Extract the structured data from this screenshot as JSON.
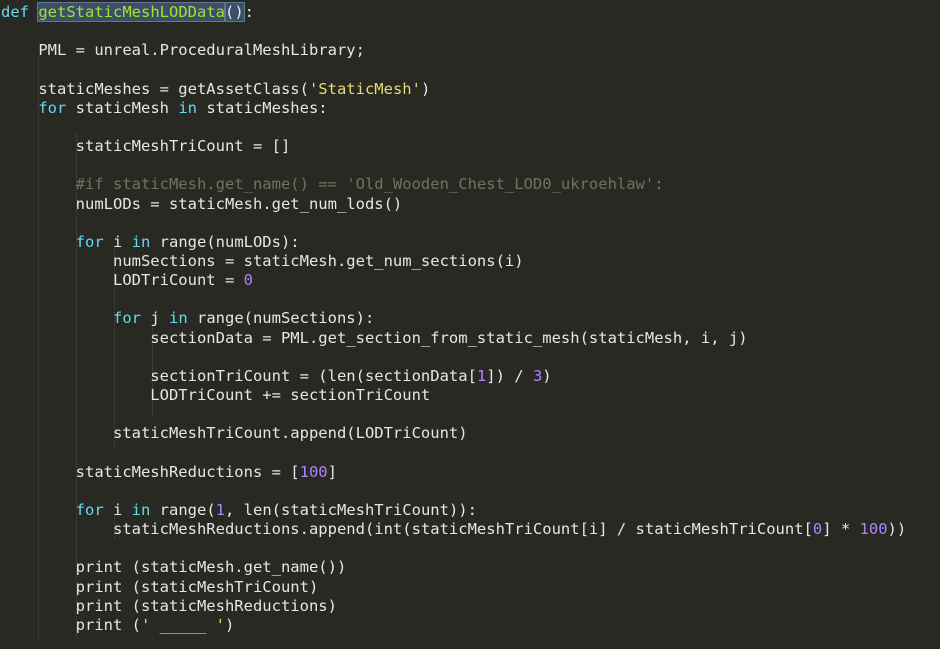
{
  "editor": {
    "background": "#282923",
    "lines": [
      {
        "tokens": [
          {
            "t": "def",
            "c": "kw"
          },
          {
            "t": " ",
            "c": "plain"
          },
          {
            "t": "getStaticMeshLODData",
            "c": "fn",
            "s": 1
          },
          {
            "t": "()",
            "c": "plain",
            "s": 1
          },
          {
            "t": ":",
            "c": "plain"
          }
        ]
      },
      {
        "tokens": []
      },
      {
        "tokens": [
          {
            "t": "    PML = unreal.ProceduralMeshLibrary;",
            "c": "plain"
          }
        ]
      },
      {
        "tokens": []
      },
      {
        "tokens": [
          {
            "t": "    staticMeshes = getAssetClass(",
            "c": "plain"
          },
          {
            "t": "'StaticMesh'",
            "c": "str"
          },
          {
            "t": ")",
            "c": "plain"
          }
        ]
      },
      {
        "tokens": [
          {
            "t": "    ",
            "c": "plain"
          },
          {
            "t": "for",
            "c": "kw"
          },
          {
            "t": " staticMesh ",
            "c": "plain"
          },
          {
            "t": "in",
            "c": "kw"
          },
          {
            "t": " staticMeshes:",
            "c": "plain"
          }
        ]
      },
      {
        "tokens": []
      },
      {
        "tokens": [
          {
            "t": "        staticMeshTriCount = []",
            "c": "plain"
          }
        ]
      },
      {
        "tokens": []
      },
      {
        "tokens": [
          {
            "t": "        #if staticMesh.get_name() == 'Old_Wooden_Chest_LOD0_ukroehlaw':",
            "c": "cm"
          }
        ]
      },
      {
        "tokens": [
          {
            "t": "        numLODs = staticMesh.get_num_lods()",
            "c": "plain"
          }
        ]
      },
      {
        "tokens": []
      },
      {
        "tokens": [
          {
            "t": "        ",
            "c": "plain"
          },
          {
            "t": "for",
            "c": "kw"
          },
          {
            "t": " i ",
            "c": "plain"
          },
          {
            "t": "in",
            "c": "kw"
          },
          {
            "t": " range(numLODs):",
            "c": "plain"
          }
        ]
      },
      {
        "tokens": [
          {
            "t": "            numSections = staticMesh.get_num_sections(i)",
            "c": "plain"
          }
        ]
      },
      {
        "tokens": [
          {
            "t": "            LODTriCount = ",
            "c": "plain"
          },
          {
            "t": "0",
            "c": "num"
          }
        ]
      },
      {
        "tokens": []
      },
      {
        "tokens": [
          {
            "t": "            ",
            "c": "plain"
          },
          {
            "t": "for",
            "c": "kw"
          },
          {
            "t": " j ",
            "c": "plain"
          },
          {
            "t": "in",
            "c": "kw"
          },
          {
            "t": " range(numSections):",
            "c": "plain"
          }
        ]
      },
      {
        "tokens": [
          {
            "t": "                sectionData = PML.get_section_from_static_mesh(staticMesh, i, j)",
            "c": "plain"
          }
        ]
      },
      {
        "tokens": []
      },
      {
        "tokens": [
          {
            "t": "                sectionTriCount = (len(sectionData[",
            "c": "plain"
          },
          {
            "t": "1",
            "c": "num"
          },
          {
            "t": "]) / ",
            "c": "plain"
          },
          {
            "t": "3",
            "c": "num"
          },
          {
            "t": ")",
            "c": "plain"
          }
        ]
      },
      {
        "tokens": [
          {
            "t": "                LODTriCount += sectionTriCount",
            "c": "plain"
          }
        ]
      },
      {
        "tokens": []
      },
      {
        "tokens": [
          {
            "t": "            staticMeshTriCount.append(LODTriCount)",
            "c": "plain"
          }
        ]
      },
      {
        "tokens": []
      },
      {
        "tokens": [
          {
            "t": "        staticMeshReductions = [",
            "c": "plain"
          },
          {
            "t": "100",
            "c": "num"
          },
          {
            "t": "]",
            "c": "plain"
          }
        ]
      },
      {
        "tokens": []
      },
      {
        "tokens": [
          {
            "t": "        ",
            "c": "plain"
          },
          {
            "t": "for",
            "c": "kw"
          },
          {
            "t": " i ",
            "c": "plain"
          },
          {
            "t": "in",
            "c": "kw"
          },
          {
            "t": " range(",
            "c": "plain"
          },
          {
            "t": "1",
            "c": "num"
          },
          {
            "t": ", len(staticMeshTriCount)):",
            "c": "plain"
          }
        ]
      },
      {
        "tokens": [
          {
            "t": "            staticMeshReductions.append(int(staticMeshTriCount[i] / staticMeshTriCount[",
            "c": "plain"
          },
          {
            "t": "0",
            "c": "num"
          },
          {
            "t": "] * ",
            "c": "plain"
          },
          {
            "t": "100",
            "c": "num"
          },
          {
            "t": "))",
            "c": "plain"
          }
        ]
      },
      {
        "tokens": []
      },
      {
        "tokens": [
          {
            "t": "        print (staticMesh.get_name())",
            "c": "plain"
          }
        ]
      },
      {
        "tokens": [
          {
            "t": "        print (staticMeshTriCount)",
            "c": "plain"
          }
        ]
      },
      {
        "tokens": [
          {
            "t": "        print (staticMeshReductions)",
            "c": "plain"
          }
        ]
      },
      {
        "tokens": [
          {
            "t": "        print (",
            "c": "plain"
          },
          {
            "t": "' _____ '",
            "c": "str"
          },
          {
            "t": ")",
            "c": "plain"
          }
        ]
      }
    ]
  }
}
